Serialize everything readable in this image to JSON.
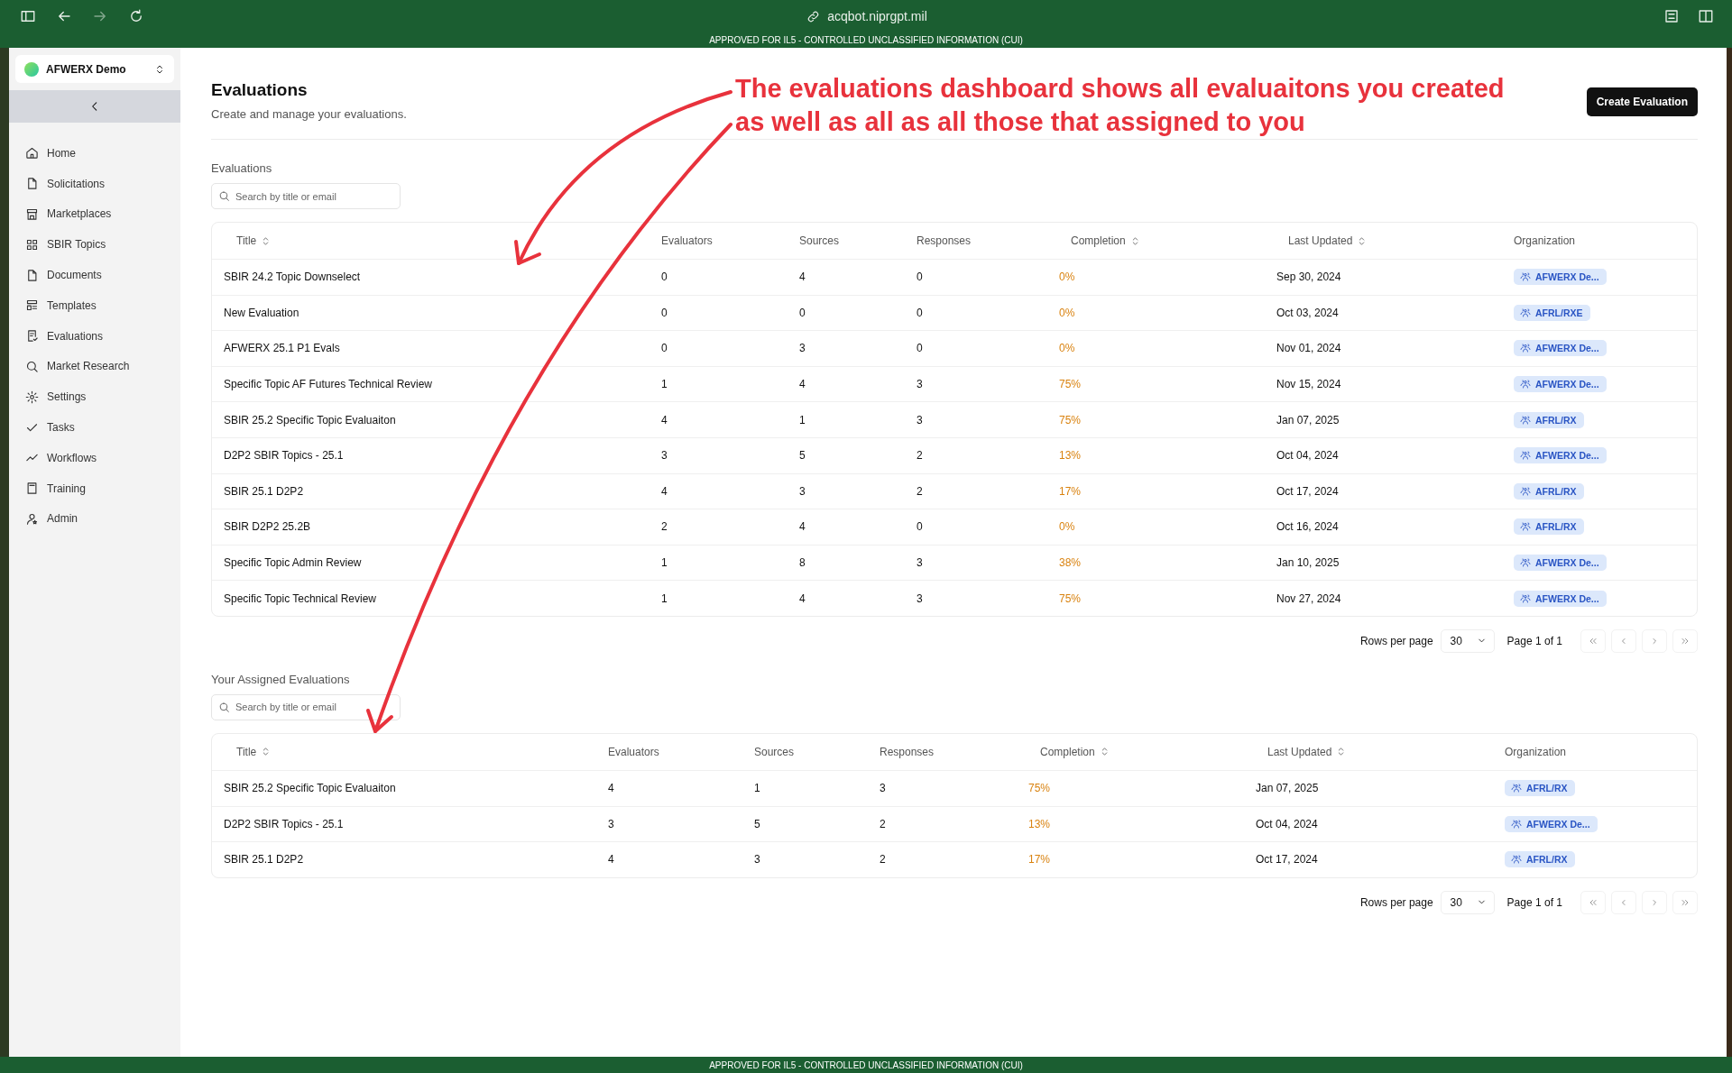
{
  "browser": {
    "url": "acqbot.niprgpt.mil"
  },
  "banner_top": "APPROVED FOR IL5 - CONTROLLED UNCLASSIFIED INFORMATION (CUI)",
  "sidebar": {
    "org": {
      "name": "AFWERX Demo"
    },
    "items": [
      {
        "label": "Home"
      },
      {
        "label": "Solicitations"
      },
      {
        "label": "Marketplaces"
      },
      {
        "label": "SBIR Topics"
      },
      {
        "label": "Documents"
      },
      {
        "label": "Templates"
      },
      {
        "label": "Evaluations"
      },
      {
        "label": "Market Research"
      },
      {
        "label": "Settings"
      },
      {
        "label": "Tasks"
      },
      {
        "label": "Workflows"
      },
      {
        "label": "Training"
      },
      {
        "label": "Admin"
      }
    ]
  },
  "page": {
    "title": "Evaluations",
    "subtitle": "Create and manage your evaluations.",
    "create_button": "Create Evaluation"
  },
  "annotation": {
    "text": "The evaluations dashboard shows all evaluaitons you created as well as all as all those that assigned to you"
  },
  "sections": [
    {
      "label": "Evaluations",
      "search_placeholder": "Search by title or email",
      "columns": [
        {
          "label": "Title",
          "sortable": true
        },
        {
          "label": "Evaluators",
          "sortable": false
        },
        {
          "label": "Sources",
          "sortable": false
        },
        {
          "label": "Responses",
          "sortable": false
        },
        {
          "label": "Completion",
          "sortable": true
        },
        {
          "label": "Last Updated",
          "sortable": true
        },
        {
          "label": "Organization",
          "sortable": false
        }
      ],
      "rows": [
        {
          "title": "SBIR 24.2 Topic Downselect",
          "evaluators": "0",
          "sources": "4",
          "responses": "0",
          "completion": "0%",
          "last_updated": "Sep 30, 2024",
          "organization": "AFWERX De..."
        },
        {
          "title": "New Evaluation",
          "evaluators": "0",
          "sources": "0",
          "responses": "0",
          "completion": "0%",
          "last_updated": "Oct 03, 2024",
          "organization": "AFRL/RXE"
        },
        {
          "title": "AFWERX 25.1 P1 Evals",
          "evaluators": "0",
          "sources": "3",
          "responses": "0",
          "completion": "0%",
          "last_updated": "Nov 01, 2024",
          "organization": "AFWERX De..."
        },
        {
          "title": "Specific Topic AF Futures Technical Review",
          "evaluators": "1",
          "sources": "4",
          "responses": "3",
          "completion": "75%",
          "last_updated": "Nov 15, 2024",
          "organization": "AFWERX De..."
        },
        {
          "title": "SBIR 25.2 Specific Topic Evaluaiton",
          "evaluators": "4",
          "sources": "1",
          "responses": "3",
          "completion": "75%",
          "last_updated": "Jan 07, 2025",
          "organization": "AFRL/RX"
        },
        {
          "title": "D2P2 SBIR Topics - 25.1",
          "evaluators": "3",
          "sources": "5",
          "responses": "2",
          "completion": "13%",
          "last_updated": "Oct 04, 2024",
          "organization": "AFWERX De..."
        },
        {
          "title": "SBIR 25.1 D2P2",
          "evaluators": "4",
          "sources": "3",
          "responses": "2",
          "completion": "17%",
          "last_updated": "Oct 17, 2024",
          "organization": "AFRL/RX"
        },
        {
          "title": "SBIR D2P2 25.2B",
          "evaluators": "2",
          "sources": "4",
          "responses": "0",
          "completion": "0%",
          "last_updated": "Oct 16, 2024",
          "organization": "AFRL/RX"
        },
        {
          "title": "Specific Topic Admin Review",
          "evaluators": "1",
          "sources": "8",
          "responses": "3",
          "completion": "38%",
          "last_updated": "Jan 10, 2025",
          "organization": "AFWERX De..."
        },
        {
          "title": "Specific Topic Technical Review",
          "evaluators": "1",
          "sources": "4",
          "responses": "3",
          "completion": "75%",
          "last_updated": "Nov 27, 2024",
          "organization": "AFWERX De..."
        }
      ],
      "pagination": {
        "rows_label": "Rows per page",
        "rows_per_page": "30",
        "page": "Page 1 of 1"
      }
    },
    {
      "label": "Your Assigned Evaluations",
      "search_placeholder": "Search by title or email",
      "columns": [
        {
          "label": "Title",
          "sortable": true
        },
        {
          "label": "Evaluators",
          "sortable": false
        },
        {
          "label": "Sources",
          "sortable": false
        },
        {
          "label": "Responses",
          "sortable": false
        },
        {
          "label": "Completion",
          "sortable": true
        },
        {
          "label": "Last Updated",
          "sortable": true
        },
        {
          "label": "Organization",
          "sortable": false
        }
      ],
      "rows": [
        {
          "title": "SBIR 25.2 Specific Topic Evaluaiton",
          "evaluators": "4",
          "sources": "1",
          "responses": "3",
          "completion": "75%",
          "last_updated": "Jan 07, 2025",
          "organization": "AFRL/RX"
        },
        {
          "title": "D2P2 SBIR Topics - 25.1",
          "evaluators": "3",
          "sources": "5",
          "responses": "2",
          "completion": "13%",
          "last_updated": "Oct 04, 2024",
          "organization": "AFWERX De..."
        },
        {
          "title": "SBIR 25.1 D2P2",
          "evaluators": "4",
          "sources": "3",
          "responses": "2",
          "completion": "17%",
          "last_updated": "Oct 17, 2024",
          "organization": "AFRL/RX"
        }
      ],
      "pagination": {
        "rows_label": "Rows per page",
        "rows_per_page": "30",
        "page": "Page 1 of 1"
      }
    }
  ],
  "banner_bottom": "APPROVED FOR IL5 - CONTROLLED UNCLASSIFIED INFORMATION (CUI)"
}
